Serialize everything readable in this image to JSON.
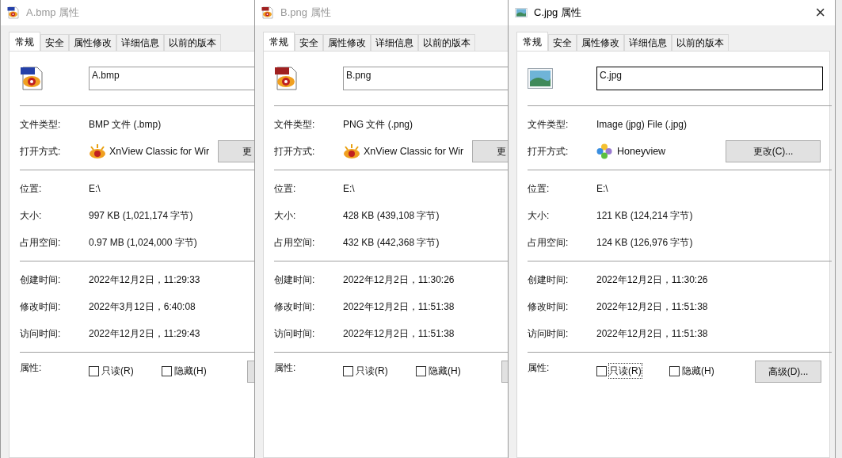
{
  "windows": [
    {
      "title": "A.bmp 属性",
      "active": false,
      "cut_off": true,
      "file_icon": {
        "kind": "bmp"
      },
      "tabs": [
        {
          "label": "常规",
          "selected": true
        },
        {
          "label": "安全",
          "selected": false
        },
        {
          "label": "属性修改",
          "selected": false
        },
        {
          "label": "详细信息",
          "selected": false
        },
        {
          "label": "以前的版本",
          "selected": false
        }
      ],
      "file_name": "A.bmp",
      "type_label": "文件类型:",
      "type_value": "BMP 文件 (.bmp)",
      "open_label": "打开方式:",
      "open_app": "XnView Classic for Wir",
      "app_icon": {
        "kind": "xnview"
      },
      "change_button": "更",
      "groups": [
        [
          {
            "label": "位置:",
            "value": "E:\\"
          },
          {
            "label": "大小:",
            "value": "997 KB (1,021,174 字节)"
          },
          {
            "label": "占用空间:",
            "value": "0.97 MB (1,024,000 字节)"
          }
        ],
        [
          {
            "label": "创建时间:",
            "value": "2022年12月2日，11:29:33"
          },
          {
            "label": "修改时间:",
            "value": "2022年3月12日，6:40:08"
          },
          {
            "label": "访问时间:",
            "value": "2022年12月2日，11:29:43"
          }
        ]
      ],
      "attr_label": "属性:",
      "checkboxes": [
        {
          "label": "只读(R)",
          "checked": false,
          "focused": false
        },
        {
          "label": "隐藏(H)",
          "checked": false,
          "focused": false
        }
      ]
    },
    {
      "title": "B.png 属性",
      "active": false,
      "cut_off": true,
      "file_icon": {
        "kind": "png"
      },
      "tabs": [
        {
          "label": "常规",
          "selected": true
        },
        {
          "label": "安全",
          "selected": false
        },
        {
          "label": "属性修改",
          "selected": false
        },
        {
          "label": "详细信息",
          "selected": false
        },
        {
          "label": "以前的版本",
          "selected": false
        }
      ],
      "file_name": "B.png",
      "type_label": "文件类型:",
      "type_value": "PNG 文件 (.png)",
      "open_label": "打开方式:",
      "open_app": "XnView Classic for Wir",
      "app_icon": {
        "kind": "xnview"
      },
      "change_button": "更",
      "groups": [
        [
          {
            "label": "位置:",
            "value": "E:\\"
          },
          {
            "label": "大小:",
            "value": "428 KB (439,108 字节)"
          },
          {
            "label": "占用空间:",
            "value": "432 KB (442,368 字节)"
          }
        ],
        [
          {
            "label": "创建时间:",
            "value": "2022年12月2日，11:30:26"
          },
          {
            "label": "修改时间:",
            "value": "2022年12月2日，11:51:38"
          },
          {
            "label": "访问时间:",
            "value": "2022年12月2日，11:51:38"
          }
        ]
      ],
      "attr_label": "属性:",
      "checkboxes": [
        {
          "label": "只读(R)",
          "checked": false,
          "focused": false
        },
        {
          "label": "隐藏(H)",
          "checked": false,
          "focused": false
        }
      ]
    },
    {
      "title": "C.jpg 属性",
      "active": true,
      "cut_off": false,
      "close": "×",
      "file_icon": {
        "kind": "image"
      },
      "tabs": [
        {
          "label": "常规",
          "selected": true
        },
        {
          "label": "安全",
          "selected": false
        },
        {
          "label": "属性修改",
          "selected": false
        },
        {
          "label": "详细信息",
          "selected": false
        },
        {
          "label": "以前的版本",
          "selected": false
        }
      ],
      "file_name": "C.jpg",
      "type_label": "文件类型:",
      "type_value": "Image (jpg) File (.jpg)",
      "open_label": "打开方式:",
      "open_app": "Honeyview",
      "app_icon": {
        "kind": "honeyview"
      },
      "change_button": "更改(C)...",
      "groups": [
        [
          {
            "label": "位置:",
            "value": "E:\\"
          },
          {
            "label": "大小:",
            "value": "121 KB (124,214 字节)"
          },
          {
            "label": "占用空间:",
            "value": "124 KB (126,976 字节)"
          }
        ],
        [
          {
            "label": "创建时间:",
            "value": "2022年12月2日，11:30:26"
          },
          {
            "label": "修改时间:",
            "value": "2022年12月2日，11:51:38"
          },
          {
            "label": "访问时间:",
            "value": "2022年12月2日，11:51:38"
          }
        ]
      ],
      "attr_label": "属性:",
      "checkboxes": [
        {
          "label": "只读(R)",
          "checked": false,
          "focused": true
        },
        {
          "label": "隐藏(H)",
          "checked": false,
          "focused": false
        }
      ],
      "advanced_button": "高级(D)..."
    }
  ]
}
